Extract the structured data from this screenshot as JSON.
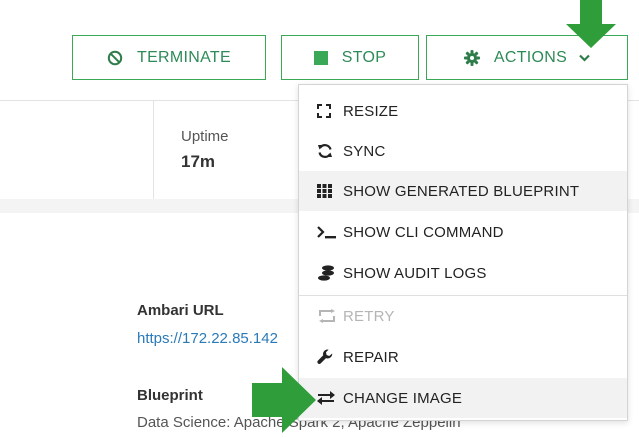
{
  "toolbar": {
    "terminate_label": "TERMINATE",
    "stop_label": "STOP",
    "actions_label": "ACTIONS"
  },
  "stats": {
    "uptime_label": "Uptime",
    "uptime_value": "17m"
  },
  "details": {
    "ambari_label": "Ambari URL",
    "ambari_url": "https://172.22.85.142",
    "blueprint_label": "Blueprint",
    "blueprint_value": "Data Science: Apache Spark 2, Apache Zeppelin"
  },
  "actions_menu": {
    "items": [
      {
        "label": "RESIZE",
        "icon": "resize-icon"
      },
      {
        "label": "SYNC",
        "icon": "sync-icon"
      },
      {
        "label": "SHOW GENERATED BLUEPRINT",
        "icon": "grid-icon"
      },
      {
        "label": "SHOW CLI COMMAND",
        "icon": "terminal-icon"
      },
      {
        "label": "SHOW AUDIT LOGS",
        "icon": "audit-icon"
      },
      {
        "label": "RETRY",
        "icon": "retry-icon"
      },
      {
        "label": "REPAIR",
        "icon": "wrench-icon"
      },
      {
        "label": "CHANGE IMAGE",
        "icon": "exchange-icon"
      }
    ]
  },
  "colors": {
    "accent_green": "#3aa857",
    "arrow_green": "#2e9d3a",
    "link_blue": "#2a7ab8"
  }
}
